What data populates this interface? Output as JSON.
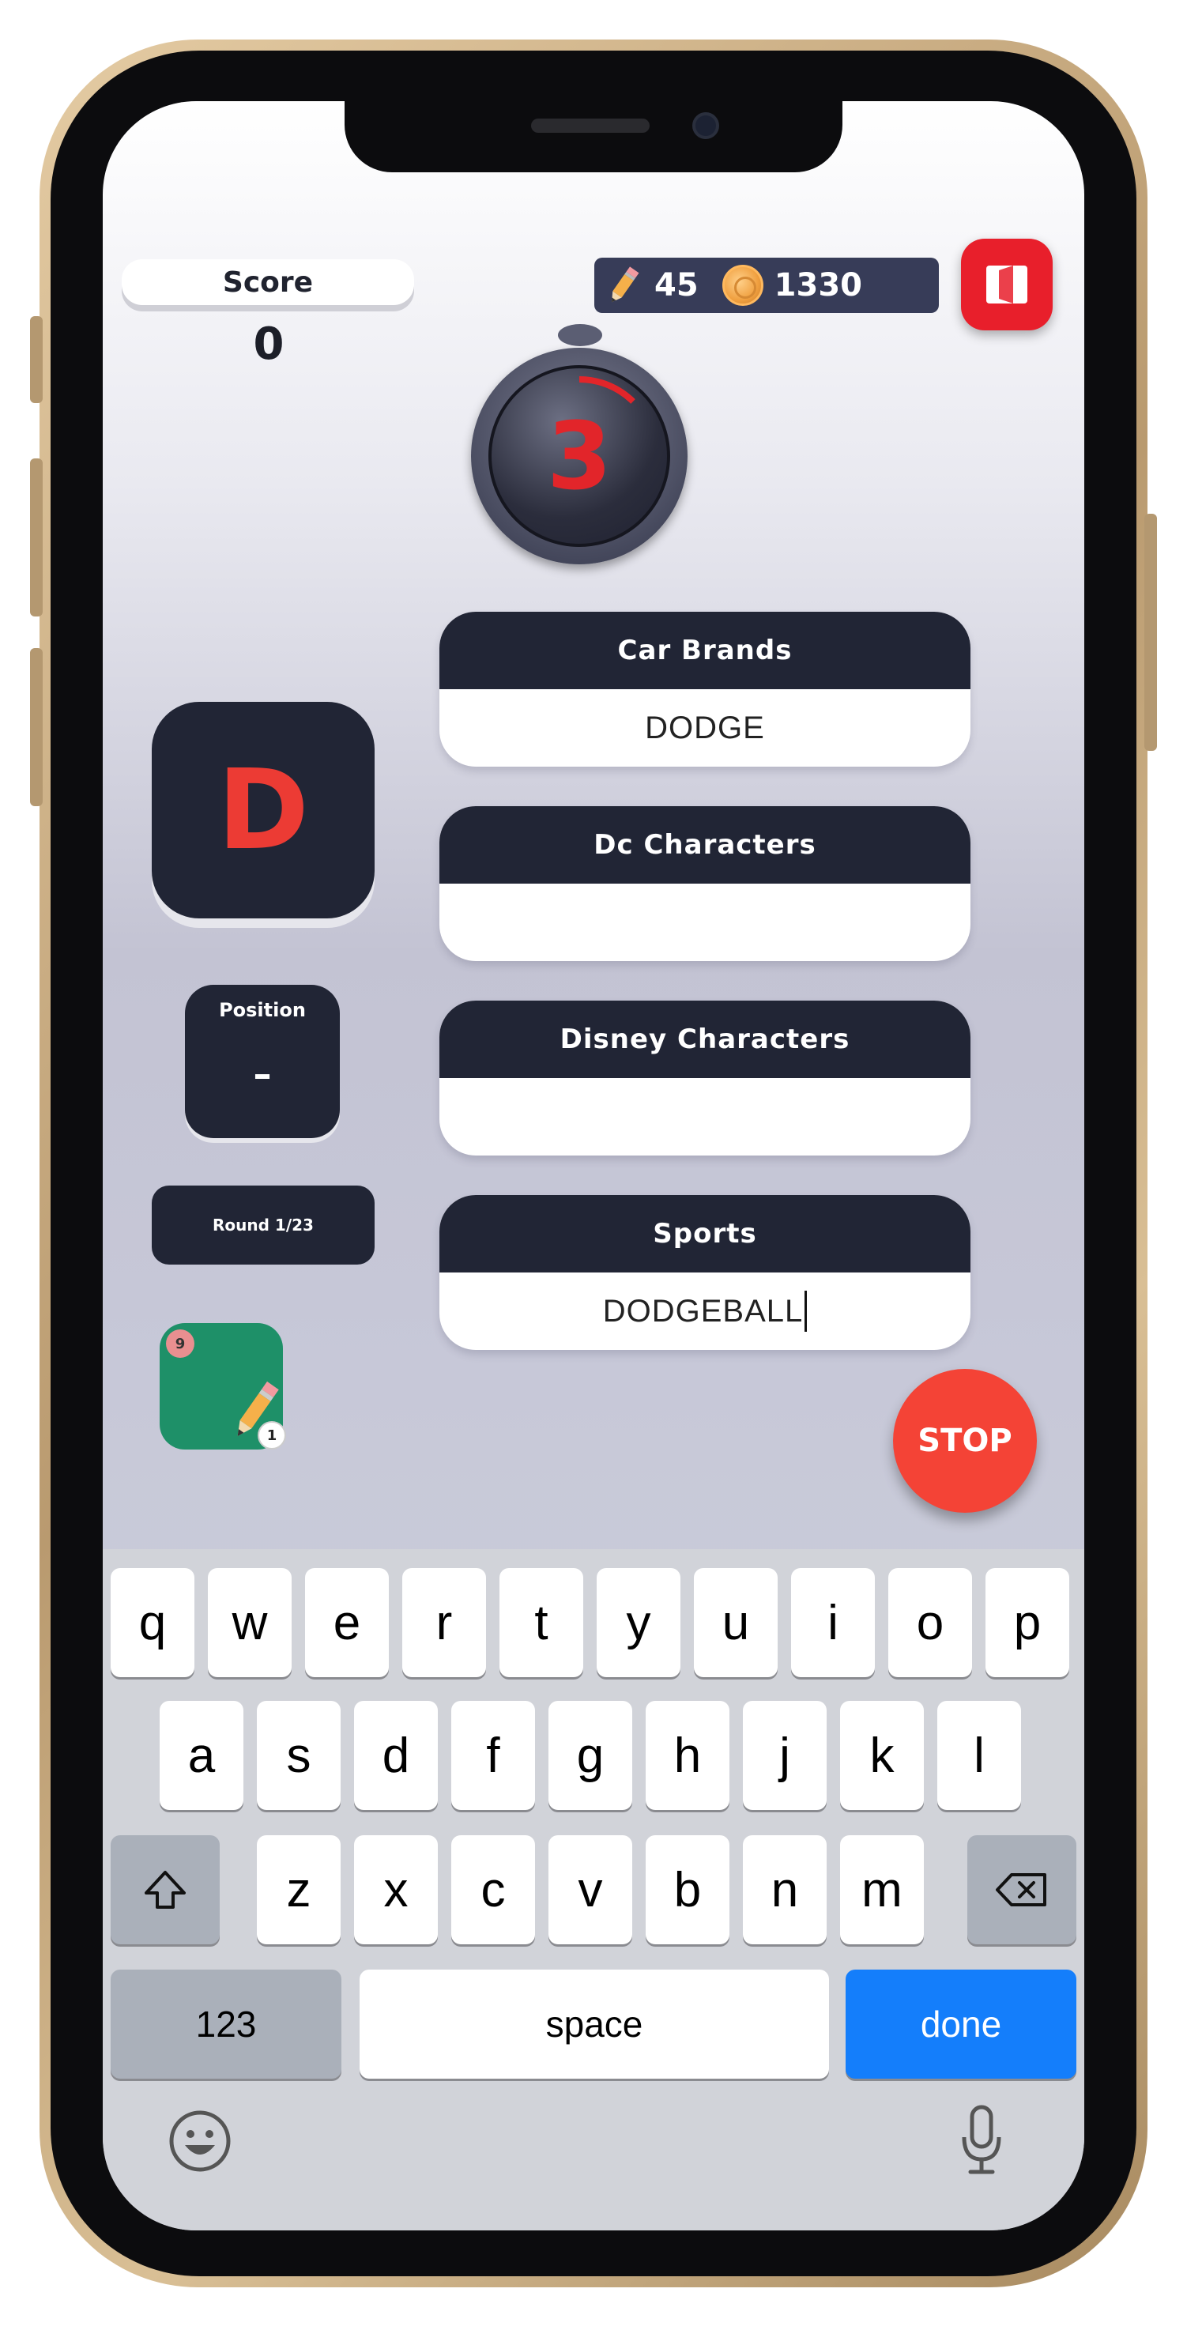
{
  "score": {
    "label": "Score",
    "value": "0"
  },
  "resources": {
    "pencils": "45",
    "coins": "1330",
    "pencil_icon": "pencil-icon",
    "coin_icon": "coin-icon"
  },
  "exit": {
    "icon": "exit-door-icon",
    "color": "#e81f2b"
  },
  "timer": {
    "value": "3"
  },
  "letter": "D",
  "position": {
    "label": "Position",
    "value": "–"
  },
  "round": {
    "label": "Round 1/23"
  },
  "powerup": {
    "badge": "9",
    "count": "1",
    "icon": "pencil-icon"
  },
  "categories": [
    {
      "title": "Car Brands",
      "answer": "DODGE"
    },
    {
      "title": "Dc Characters",
      "answer": ""
    },
    {
      "title": "Disney Characters",
      "answer": ""
    },
    {
      "title": "Sports",
      "answer": "DODGEBALL"
    }
  ],
  "stop": {
    "label": "STOP",
    "color": "#f44336"
  },
  "keyboard": {
    "row1": [
      "q",
      "w",
      "e",
      "r",
      "t",
      "y",
      "u",
      "i",
      "o",
      "p"
    ],
    "row2": [
      "a",
      "s",
      "d",
      "f",
      "g",
      "h",
      "j",
      "k",
      "l"
    ],
    "row3": [
      "z",
      "x",
      "c",
      "v",
      "b",
      "n",
      "m"
    ],
    "numbers_label": "123",
    "space_label": "space",
    "done_label": "done"
  },
  "colors": {
    "card_header": "#212535",
    "accent_red": "#ec3b34",
    "keyboard_bg": "#d1d3d9",
    "done_blue": "#147efb"
  }
}
